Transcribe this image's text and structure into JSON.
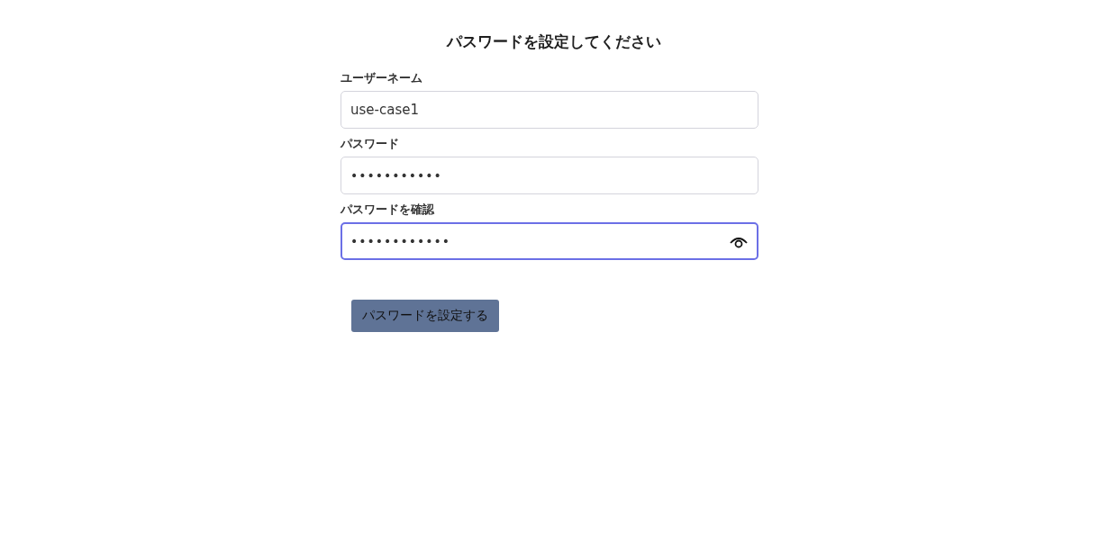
{
  "title": "パスワードを設定してください",
  "fields": [
    {
      "label": "ユーザーネーム",
      "value": "use-case1",
      "focused": false,
      "reveal_icon": false
    },
    {
      "label": "パスワード",
      "value": "•••••••••••",
      "focused": false,
      "reveal_icon": false
    },
    {
      "label": "パスワードを確認",
      "value": "••••••••••••",
      "focused": true,
      "reveal_icon": true
    }
  ],
  "submit_button": "パスワードを設定する"
}
